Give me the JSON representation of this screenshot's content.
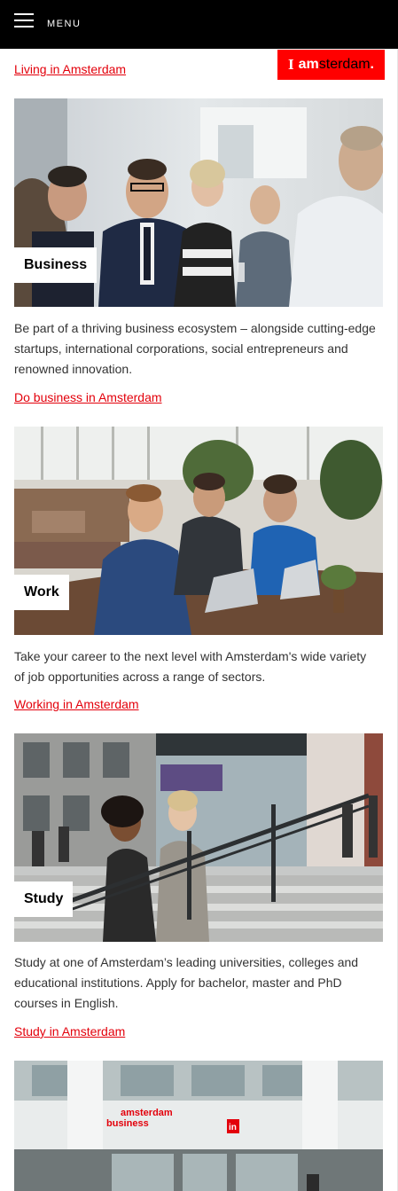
{
  "header": {
    "menu_label": "MENU"
  },
  "logo": {
    "i": "I",
    "am": "am",
    "sterdam": "sterdam",
    "dot": "."
  },
  "top_link": "Living in Amsterdam",
  "cards": [
    {
      "label": "Business",
      "description": "Be part of a thriving business ecosystem – alongside cutting-edge startups, international corporations, social entrepreneurs and renowned innovation.",
      "link": "Do business in Amsterdam"
    },
    {
      "label": "Work",
      "description": "Take your career to the next level with Amsterdam's wide variety of job opportunities across a range of sectors.",
      "link": "Working in Amsterdam"
    },
    {
      "label": "Study",
      "description": "Study at one of Amsterdam’s leading universities, colleges and educational institutions. Apply for bachelor, master and PhD courses in English.",
      "link": "Study in Amsterdam"
    }
  ],
  "building_sign": {
    "line1": "amsterdam",
    "line2": "business",
    "in_logo": "in"
  },
  "colors": {
    "accent_red": "#e3000b",
    "logo_red": "#ff0000",
    "header_bg": "#000000"
  }
}
